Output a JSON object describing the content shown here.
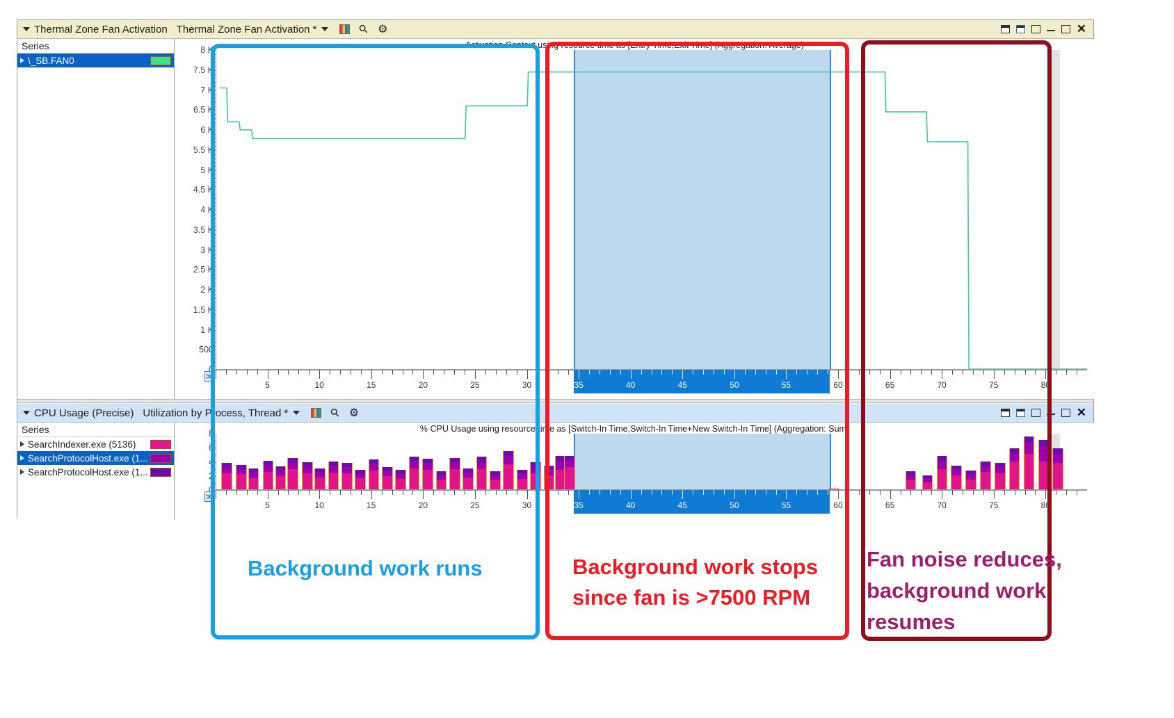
{
  "window": {
    "panels": [
      {
        "id": "thermal",
        "collapse_icon": "triangle-down-icon",
        "title": "Thermal Zone Fan Activation",
        "preset": "Thermal Zone Fan Activation",
        "star": "*",
        "caret_icon": "chevron-down-icon",
        "icons": [
          "chart-icon",
          "search-icon",
          "gear-icon"
        ],
        "window_buttons": [
          "restore-icon",
          "popout-icon",
          "maximize-icon",
          "minimize-icon",
          "restore-down-icon",
          "close-icon"
        ],
        "series_header": "Series",
        "series": [
          {
            "name": "\\_SB.FAN0",
            "color": "#3ee08a",
            "selected": true
          }
        ],
        "chart_title": "Activation Context using resource time as [Entry Time,Exit Time] (Aggregation: Average)",
        "scroll_button": "≫"
      },
      {
        "id": "cpu",
        "collapse_icon": "triangle-down-icon",
        "title": "CPU Usage (Precise)",
        "preset": "Utilization by Process, Thread",
        "star": "*",
        "caret_icon": "chevron-down-icon",
        "icons": [
          "chart-icon",
          "search-icon",
          "gear-icon"
        ],
        "window_buttons": [
          "restore-icon",
          "popout-icon",
          "maximize-icon",
          "minimize-icon",
          "restore-down-icon",
          "close-icon"
        ],
        "series_header": "Series",
        "series": [
          {
            "name": "SearchIndexer.exe (5136)",
            "color": "#e0158c",
            "selected": false
          },
          {
            "name": "SearchProtocolHost.exe (1...",
            "color": "#9a00b0",
            "selected": true
          },
          {
            "name": "SearchProtocolHost.exe (1...",
            "color": "#6a0dad",
            "selected": false
          }
        ],
        "chart_title": "% CPU Usage using resource time as [Switch-In Time,Switch-In Time+New Switch-In Time] (Aggregation: Sum)",
        "scroll_button": "≫"
      }
    ]
  },
  "annotations": [
    {
      "id": "blue",
      "text": "Background work runs",
      "color": "#1aa0e0",
      "box_color": "#1aa0e0"
    },
    {
      "id": "red",
      "line1": "Background work stops",
      "line2": "since fan is >7500 RPM",
      "color": "#ec1c24",
      "box_color": "#ec1c24"
    },
    {
      "id": "darkred",
      "line1": "Fan noise reduces,",
      "line2": "background work",
      "line3": "resumes",
      "color": "#9c1f6a",
      "box_color": "#8b0f1a"
    }
  ],
  "chart_data": [
    {
      "id": "thermal-zone-fan-activation",
      "type": "line",
      "title": "Activation Context using resource time as [Entry Time,Exit Time] (Aggregation: Average)",
      "xlabel": "",
      "ylabel": "",
      "ylim": [
        0,
        8000
      ],
      "ytick_labels": [
        "8 K",
        "7.5 K",
        "7 K",
        "6.5 K",
        "6 K",
        "5.5 K",
        "5 K",
        "4.5 K",
        "4 K",
        "3.5 K",
        "3 K",
        "2.5 K",
        "2 K",
        "1.5 K",
        "1 K",
        "500",
        "0"
      ],
      "ytick_values": [
        8000,
        7500,
        7000,
        6500,
        6000,
        5500,
        5000,
        4500,
        4000,
        3500,
        3000,
        2500,
        2000,
        1500,
        1000,
        500,
        0
      ],
      "xlim": [
        0,
        84
      ],
      "xtick_labels": [
        "5",
        "10",
        "15",
        "20",
        "25",
        "30",
        "35",
        "40",
        "45",
        "50",
        "55",
        "60",
        "65",
        "70",
        "75",
        "80"
      ],
      "xtick_values": [
        5,
        10,
        15,
        20,
        25,
        30,
        35,
        40,
        45,
        50,
        55,
        60,
        65,
        70,
        75,
        80
      ],
      "grid": false,
      "legend": "Series list (left pane)",
      "series": [
        {
          "name": "\\_SB.FAN0",
          "color": "#3ec9a0",
          "points": [
            [
              0.3,
              7050
            ],
            [
              1.0,
              7050
            ],
            [
              1.1,
              6200
            ],
            [
              2.2,
              6200
            ],
            [
              2.3,
              6000
            ],
            [
              3.4,
              6000
            ],
            [
              3.5,
              5780
            ],
            [
              24.0,
              5780
            ],
            [
              24.1,
              6600
            ],
            [
              30.0,
              6600
            ],
            [
              30.1,
              7450
            ],
            [
              59.0,
              7450
            ],
            [
              59.1,
              7450
            ],
            [
              64.5,
              7450
            ],
            [
              64.6,
              6450
            ],
            [
              68.5,
              6450
            ],
            [
              68.6,
              5700
            ],
            [
              72.5,
              5700
            ],
            [
              72.6,
              0
            ],
            [
              84,
              0
            ]
          ]
        }
      ],
      "selection": {
        "start": 34.5,
        "end": 59.2,
        "color": "#bcd9f0"
      }
    },
    {
      "id": "cpu-usage-precise",
      "type": "bar",
      "stacked": true,
      "title": "% CPU Usage using resource time as [Switch-In Time,Switch-In Time+New Switch-In Time] (Aggregation: Sum)",
      "xlabel": "",
      "ylabel": "",
      "ylim": [
        0,
        8
      ],
      "ytick_labels": [
        "8",
        "6",
        "4",
        "2",
        "0"
      ],
      "ytick_values": [
        8,
        6,
        4,
        2,
        0
      ],
      "xlim": [
        0,
        84
      ],
      "xtick_labels": [
        "5",
        "10",
        "15",
        "20",
        "25",
        "30",
        "35",
        "40",
        "45",
        "50",
        "55",
        "60",
        "65",
        "70",
        "75",
        "80"
      ],
      "xtick_values": [
        5,
        10,
        15,
        20,
        25,
        30,
        35,
        40,
        45,
        50,
        55,
        60,
        65,
        70,
        75,
        80
      ],
      "grid": false,
      "series_names": [
        "SearchIndexer.exe (5136)",
        "SearchProtocolHost.exe (1...",
        "SearchProtocolHost.exe (1..."
      ],
      "series_colors": [
        "#e0158c",
        "#9a00b0",
        "#6a0dad"
      ],
      "bars": [
        {
          "x": 1.0,
          "values": [
            2.3,
            0.9,
            0.6
          ]
        },
        {
          "x": 2.4,
          "values": [
            2.2,
            0.8,
            0.5
          ]
        },
        {
          "x": 3.6,
          "values": [
            1.6,
            0.9,
            0.5
          ]
        },
        {
          "x": 5.0,
          "values": [
            2.5,
            1.0,
            0.6
          ]
        },
        {
          "x": 6.2,
          "values": [
            1.9,
            0.9,
            0.5
          ]
        },
        {
          "x": 7.4,
          "values": [
            2.9,
            1.0,
            0.6
          ]
        },
        {
          "x": 8.8,
          "values": [
            2.3,
            1.0,
            0.6
          ]
        },
        {
          "x": 10.0,
          "values": [
            1.7,
            0.8,
            0.5
          ]
        },
        {
          "x": 11.3,
          "values": [
            2.4,
            1.0,
            0.6
          ]
        },
        {
          "x": 12.6,
          "values": [
            2.3,
            0.9,
            0.6
          ]
        },
        {
          "x": 13.9,
          "values": [
            1.6,
            0.7,
            0.5
          ]
        },
        {
          "x": 15.2,
          "values": [
            2.7,
            1.0,
            0.6
          ]
        },
        {
          "x": 16.5,
          "values": [
            1.9,
            0.8,
            0.5
          ]
        },
        {
          "x": 17.8,
          "values": [
            1.5,
            0.8,
            0.5
          ]
        },
        {
          "x": 19.1,
          "values": [
            3.0,
            1.0,
            0.7
          ]
        },
        {
          "x": 20.4,
          "values": [
            2.8,
            1.0,
            0.6
          ]
        },
        {
          "x": 21.7,
          "values": [
            1.4,
            0.7,
            0.5
          ]
        },
        {
          "x": 23.0,
          "values": [
            2.9,
            1.0,
            0.6
          ]
        },
        {
          "x": 24.3,
          "values": [
            1.7,
            0.8,
            0.5
          ]
        },
        {
          "x": 25.6,
          "values": [
            3.0,
            1.0,
            0.7
          ]
        },
        {
          "x": 26.9,
          "values": [
            1.4,
            0.7,
            0.5
          ]
        },
        {
          "x": 28.2,
          "values": [
            3.6,
            1.2,
            0.7
          ]
        },
        {
          "x": 29.5,
          "values": [
            1.5,
            0.8,
            0.5
          ]
        },
        {
          "x": 30.8,
          "values": [
            2.3,
            1.0,
            0.6
          ]
        },
        {
          "x": 32.1,
          "values": [
            2.0,
            0.9,
            0.5
          ]
        },
        {
          "x": 33.2,
          "values": [
            2.8,
            1.2,
            0.8
          ]
        },
        {
          "x": 34.1,
          "values": [
            3.2,
            1.0,
            0.6
          ]
        },
        {
          "x": 59.6,
          "values": [
            0.12,
            0,
            0
          ]
        },
        {
          "x": 67.0,
          "values": [
            1.3,
            0.8,
            0.5
          ]
        },
        {
          "x": 68.6,
          "values": [
            1.0,
            0.6,
            0.4
          ]
        },
        {
          "x": 70.0,
          "values": [
            2.9,
            1.2,
            0.7
          ]
        },
        {
          "x": 71.4,
          "values": [
            2.0,
            0.9,
            0.5
          ]
        },
        {
          "x": 72.8,
          "values": [
            1.4,
            0.8,
            0.5
          ]
        },
        {
          "x": 74.2,
          "values": [
            2.5,
            0.9,
            0.6
          ]
        },
        {
          "x": 75.6,
          "values": [
            2.3,
            0.9,
            0.6
          ]
        },
        {
          "x": 77.0,
          "values": [
            4.0,
            1.2,
            0.7
          ]
        },
        {
          "x": 78.4,
          "values": [
            5.1,
            1.6,
            0.9
          ]
        },
        {
          "x": 79.8,
          "values": [
            4.0,
            2.2,
            0.9
          ]
        },
        {
          "x": 81.2,
          "values": [
            3.8,
            1.3,
            0.8
          ]
        }
      ],
      "selection": {
        "start": 34.5,
        "end": 59.2,
        "color": "#bcd9f0"
      }
    }
  ]
}
